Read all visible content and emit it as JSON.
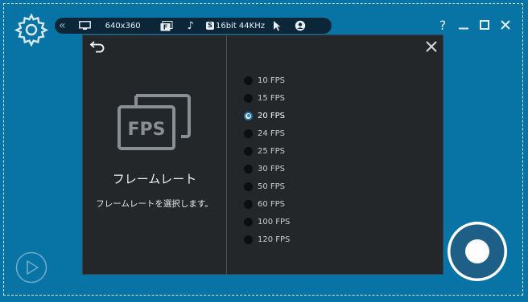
{
  "toolbar": {
    "collapse_icon": "double-chevron-left-icon",
    "resolution": "640x360",
    "fps_badge": "F",
    "audio_badge": "S",
    "audio_format": "16bit 44KHz"
  },
  "window": {
    "help_label": "?"
  },
  "dialog": {
    "title": "フレームレート",
    "description": "フレームレートを選択します。",
    "fps_graphic_text": "FPS",
    "options": [
      {
        "label": "10 FPS",
        "selected": false
      },
      {
        "label": "15 FPS",
        "selected": false
      },
      {
        "label": "20 FPS",
        "selected": true
      },
      {
        "label": "24 FPS",
        "selected": false
      },
      {
        "label": "25 FPS",
        "selected": false
      },
      {
        "label": "30 FPS",
        "selected": false
      },
      {
        "label": "50 FPS",
        "selected": false
      },
      {
        "label": "60 FPS",
        "selected": false
      },
      {
        "label": "100 FPS",
        "selected": false
      },
      {
        "label": "120 FPS",
        "selected": false
      }
    ]
  },
  "colors": {
    "background": "#0874a6",
    "panel": "#23272a",
    "toolbar": "#0b2638",
    "selected_radio": "#2b8ad0",
    "record_button": "#1d5f86"
  }
}
